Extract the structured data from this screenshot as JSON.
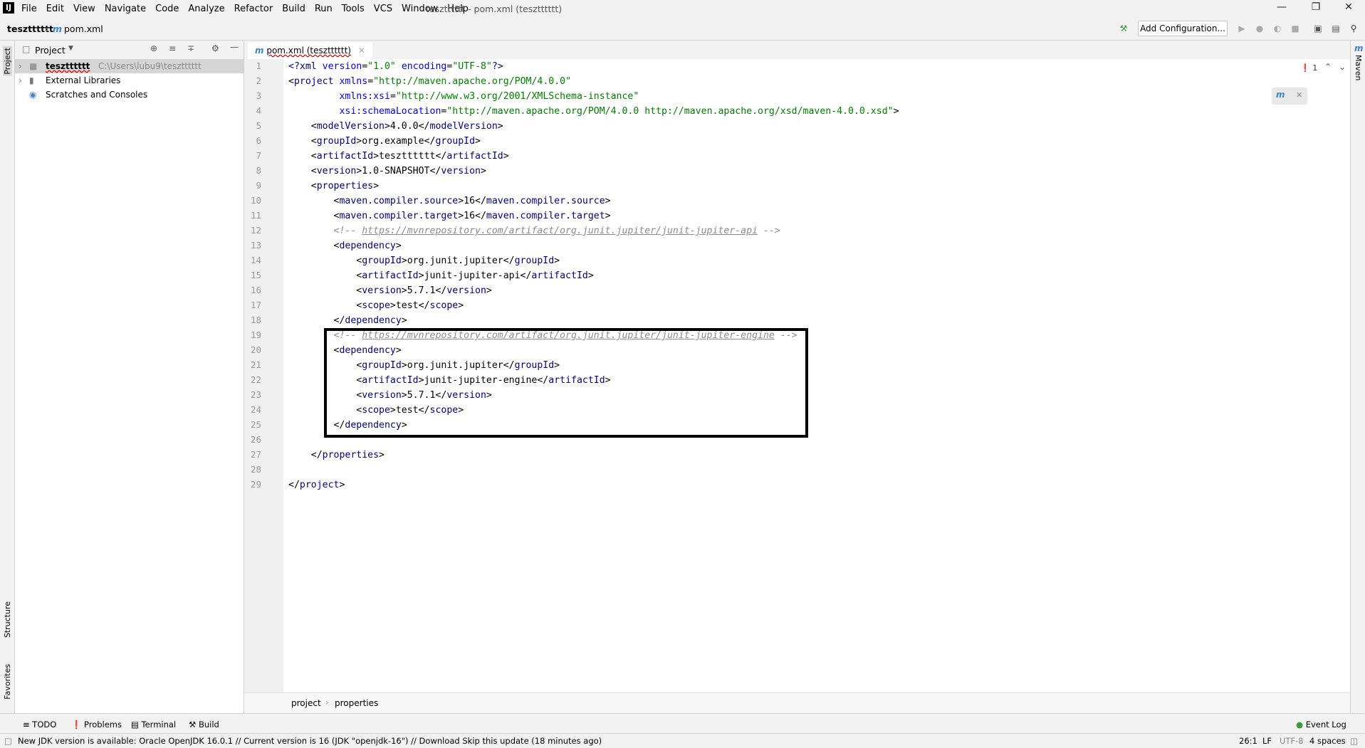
{
  "app": {
    "window_title": "tesztttttt - pom.xml (tesztttttt)",
    "logo_text": "IJ",
    "menu": [
      "File",
      "Edit",
      "View",
      "Navigate",
      "Code",
      "Analyze",
      "Refactor",
      "Build",
      "Run",
      "Tools",
      "VCS",
      "Window",
      "Help"
    ]
  },
  "navbar": {
    "project": "tesztttttt",
    "file": "pom.xml",
    "add_configuration": "Add Configuration..."
  },
  "left_stripe": {
    "project": "Project",
    "structure": "Structure",
    "favorites": "Favorites"
  },
  "project_panel": {
    "title": "Project",
    "items": [
      {
        "label": "tesztttttt",
        "path": "C:\\Users\\lubu9\\tesztttttt"
      },
      {
        "label": "External Libraries"
      },
      {
        "label": "Scratches and Consoles"
      }
    ]
  },
  "editor": {
    "tab": "pom.xml (tesztttttt)",
    "error_count": "1",
    "lines": [
      "1",
      "2",
      "3",
      "4",
      "5",
      "6",
      "7",
      "8",
      "9",
      "10",
      "11",
      "12",
      "13",
      "14",
      "15",
      "16",
      "17",
      "18",
      "19",
      "20",
      "21",
      "22",
      "23",
      "24",
      "25",
      "26",
      "27",
      "28",
      "29"
    ],
    "breadcrumb": [
      "project",
      "properties"
    ]
  },
  "right_stripe": {
    "maven": "Maven"
  },
  "tool_windows": [
    "TODO",
    "Problems",
    "Terminal",
    "Build"
  ],
  "event_log": "Event Log",
  "status": {
    "message": "New JDK version is available: Oracle OpenJDK 16.0.1 // Current version is 16 (JDK \"openjdk-16\") // Download   Skip this update (18 minutes ago)",
    "position": "26:1",
    "line_sep": "LF",
    "encoding": "UTF-8",
    "indent": "4 spaces"
  }
}
